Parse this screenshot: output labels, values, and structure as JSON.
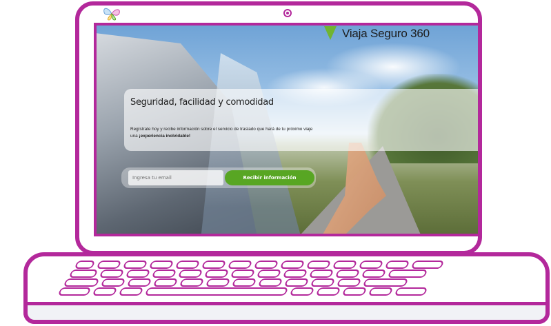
{
  "brand": {
    "name": "Viaja Seguro 360",
    "accent_color": "#71b431",
    "logo_icon": "map-pin-icon"
  },
  "device": {
    "frame_color": "#b3289b",
    "webcam_icon": "webcam-icon",
    "corner_logo_icon": "butterfly-icon"
  },
  "hero": {
    "title": "Seguridad, facilidad y comodidad",
    "description_prefix": "Regístrate hoy y recibe información sobre el servicio de traslado que hará de tu próximo viaje una ",
    "description_highlight": "¡experiencia inolvidable!"
  },
  "signup_form": {
    "email_placeholder": "Ingresa tu email",
    "submit_label": "Recibir información",
    "button_color": "#58a623"
  }
}
